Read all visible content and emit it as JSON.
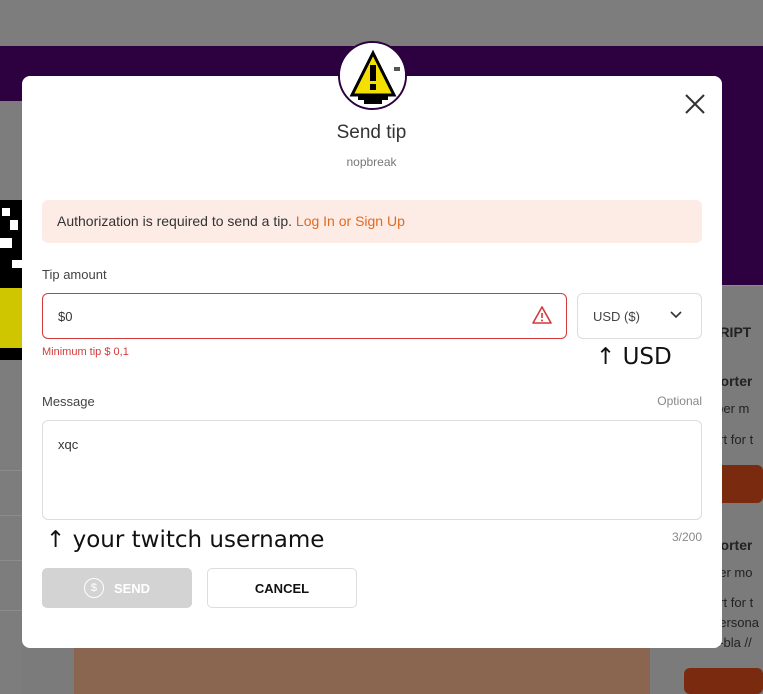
{
  "background": {
    "right_heading": "SCRIPT",
    "right_items": [
      "porter",
      "s per m",
      "ort for t",
      "porter",
      "per mo",
      "ort for t",
      "persona",
      "a-bla //"
    ]
  },
  "modal": {
    "avatar_icon": "warning-bell-icon",
    "title": "Send tip",
    "subtitle": "nopbreak",
    "alert": {
      "text": "Authorization is required to send a tip.",
      "link": "Log In or Sign Up"
    },
    "tip_amount": {
      "label": "Tip amount",
      "value": "$0",
      "error": "Minimum tip $ 0,1"
    },
    "currency": {
      "selected": "USD ($)"
    },
    "annotation_currency": "↑ USD",
    "message": {
      "label": "Message",
      "optional": "Optional",
      "value": "xqc",
      "counter": "3/200"
    },
    "annotation_message": "↑ your twitch username",
    "buttons": {
      "send": "SEND",
      "send_icon_glyph": "$",
      "cancel": "CANCEL"
    },
    "colors": {
      "accent": "#e06a1f",
      "error": "#d33a3a",
      "alert_bg": "#fdece5",
      "banner": "#2d0040"
    }
  }
}
